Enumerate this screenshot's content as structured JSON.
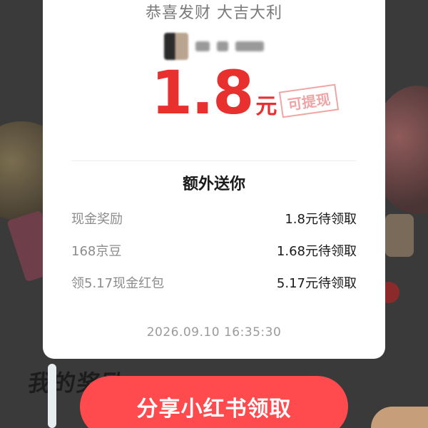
{
  "card": {
    "greeting": "恭喜发财 大吉大利",
    "amount": "1.8",
    "amount_unit": "元",
    "withdrawable_stamp": "可提现",
    "extra_title": "额外送你",
    "rewards": [
      {
        "name": "现金奖励",
        "value": "1.8元待领取"
      },
      {
        "name": "168京豆",
        "value": "1.68元待领取"
      },
      {
        "name": "领5.17现金红包",
        "value": "5.17元待领取"
      }
    ],
    "timestamp": "2026.09.10 16:35:30"
  },
  "background": {
    "section_title": "我的奖励"
  },
  "share_button": {
    "label": "分享小红书领取"
  },
  "colors": {
    "accent": "#e8302f",
    "button": "#ff4a4e"
  }
}
